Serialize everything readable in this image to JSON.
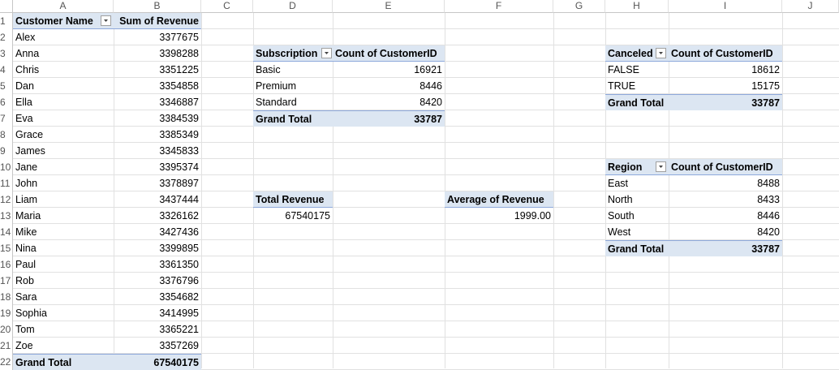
{
  "columns": [
    "A",
    "B",
    "C",
    "D",
    "E",
    "F",
    "G",
    "H",
    "I",
    "J"
  ],
  "rows": [
    "1",
    "2",
    "3",
    "4",
    "5",
    "6",
    "7",
    "8",
    "9",
    "10",
    "11",
    "12",
    "13",
    "14",
    "15",
    "16",
    "17",
    "18",
    "19",
    "20",
    "21",
    "22"
  ],
  "pivot_customer": {
    "header_name": "Customer Name",
    "header_value": "Sum of Revenue",
    "rows": [
      {
        "name": "Alex",
        "value": "3377675"
      },
      {
        "name": "Anna",
        "value": "3398288"
      },
      {
        "name": "Chris",
        "value": "3351225"
      },
      {
        "name": "Dan",
        "value": "3354858"
      },
      {
        "name": "Ella",
        "value": "3346887"
      },
      {
        "name": "Eva",
        "value": "3384539"
      },
      {
        "name": "Grace",
        "value": "3385349"
      },
      {
        "name": "James",
        "value": "3345833"
      },
      {
        "name": "Jane",
        "value": "3395374"
      },
      {
        "name": "John",
        "value": "3378897"
      },
      {
        "name": "Liam",
        "value": "3437444"
      },
      {
        "name": "Maria",
        "value": "3326162"
      },
      {
        "name": "Mike",
        "value": "3427436"
      },
      {
        "name": "Nina",
        "value": "3399895"
      },
      {
        "name": "Paul",
        "value": "3361350"
      },
      {
        "name": "Rob",
        "value": "3376796"
      },
      {
        "name": "Sara",
        "value": "3354682"
      },
      {
        "name": "Sophia",
        "value": "3414995"
      },
      {
        "name": "Tom",
        "value": "3365221"
      },
      {
        "name": "Zoe",
        "value": "3357269"
      }
    ],
    "total_label": "Grand Total",
    "total_value": "67540175"
  },
  "pivot_subscription": {
    "header_name": "Subscription",
    "header_value": "Count of CustomerID",
    "rows": [
      {
        "name": "Basic",
        "value": "16921"
      },
      {
        "name": "Premium",
        "value": "8446"
      },
      {
        "name": "Standard",
        "value": "8420"
      }
    ],
    "total_label": "Grand Total",
    "total_value": "33787"
  },
  "total_revenue": {
    "label": "Total Revenue",
    "value": "67540175"
  },
  "average_revenue": {
    "label": "Average of Revenue",
    "value": "1999.00"
  },
  "pivot_canceled": {
    "header_name": "Canceled",
    "header_value": "Count of CustomerID",
    "rows": [
      {
        "name": "FALSE",
        "value": "18612"
      },
      {
        "name": "TRUE",
        "value": "15175"
      }
    ],
    "total_label": "Grand Total",
    "total_value": "33787"
  },
  "pivot_region": {
    "header_name": "Region",
    "header_value": "Count of CustomerID",
    "rows": [
      {
        "name": "East",
        "value": "8488"
      },
      {
        "name": "North",
        "value": "8433"
      },
      {
        "name": "South",
        "value": "8446"
      },
      {
        "name": "West",
        "value": "8420"
      }
    ],
    "total_label": "Grand Total",
    "total_value": "33787"
  },
  "colors": {
    "pivot_header_bg": "#dce6f2",
    "pivot_border": "#8ea9db",
    "gridline": "#e1e1e1"
  }
}
